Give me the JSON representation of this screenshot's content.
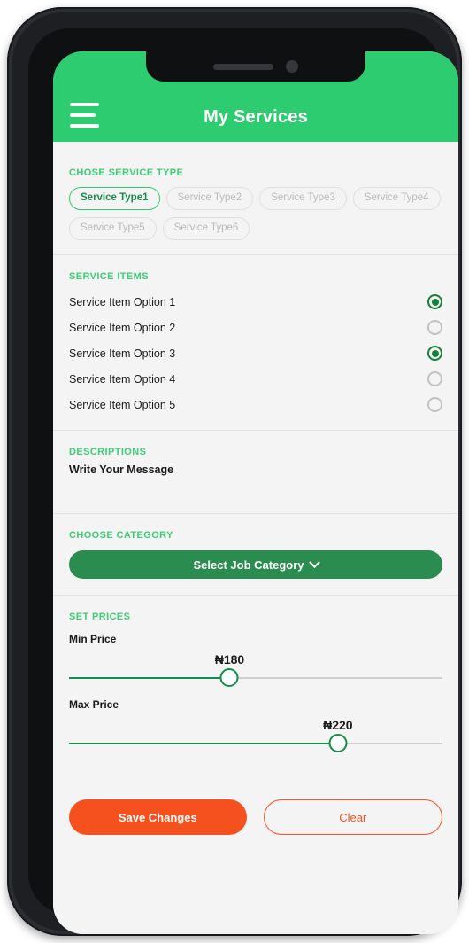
{
  "device": {
    "notch": {
      "speaker": "speaker-slot",
      "camera": "front-camera"
    }
  },
  "header": {
    "title": "My Services",
    "menu_icon": "hamburger-menu-icon",
    "background_color": "#2ecc71"
  },
  "service_type": {
    "label": "CHOSE SERVICE TYPE",
    "chips": [
      {
        "label": "Service Type1",
        "selected": true
      },
      {
        "label": "Service Type2",
        "selected": false
      },
      {
        "label": "Service Type3",
        "selected": false
      },
      {
        "label": "Service Type4",
        "selected": false
      },
      {
        "label": "Service Type5",
        "selected": false
      },
      {
        "label": "Service Type6",
        "selected": false
      }
    ]
  },
  "service_items": {
    "label": "SERVICE ITEMS",
    "items": [
      {
        "label": "Service Item Option 1",
        "checked": true
      },
      {
        "label": "Service Item Option 2",
        "checked": false
      },
      {
        "label": "Service Item Option 3",
        "checked": true
      },
      {
        "label": "Service Item Option 4",
        "checked": false
      },
      {
        "label": "Service Item Option 5",
        "checked": false
      }
    ]
  },
  "descriptions": {
    "label": "DESCRIPTIONS",
    "value": "Write Your Message",
    "placeholder": "Write Your Message"
  },
  "category": {
    "label": "CHOOSE CATEGORY",
    "selected": "Select Job Category",
    "chevron_icon": "chevron-down-icon"
  },
  "prices": {
    "label": "SET PRICES",
    "min": {
      "label": "Min Price",
      "value": "₦180",
      "percent": 43
    },
    "max": {
      "label": "Max Price",
      "value": "₦220",
      "percent": 72
    }
  },
  "actions": {
    "save": "Save Changes",
    "clear": "Clear",
    "accent_color": "#f4511e"
  }
}
